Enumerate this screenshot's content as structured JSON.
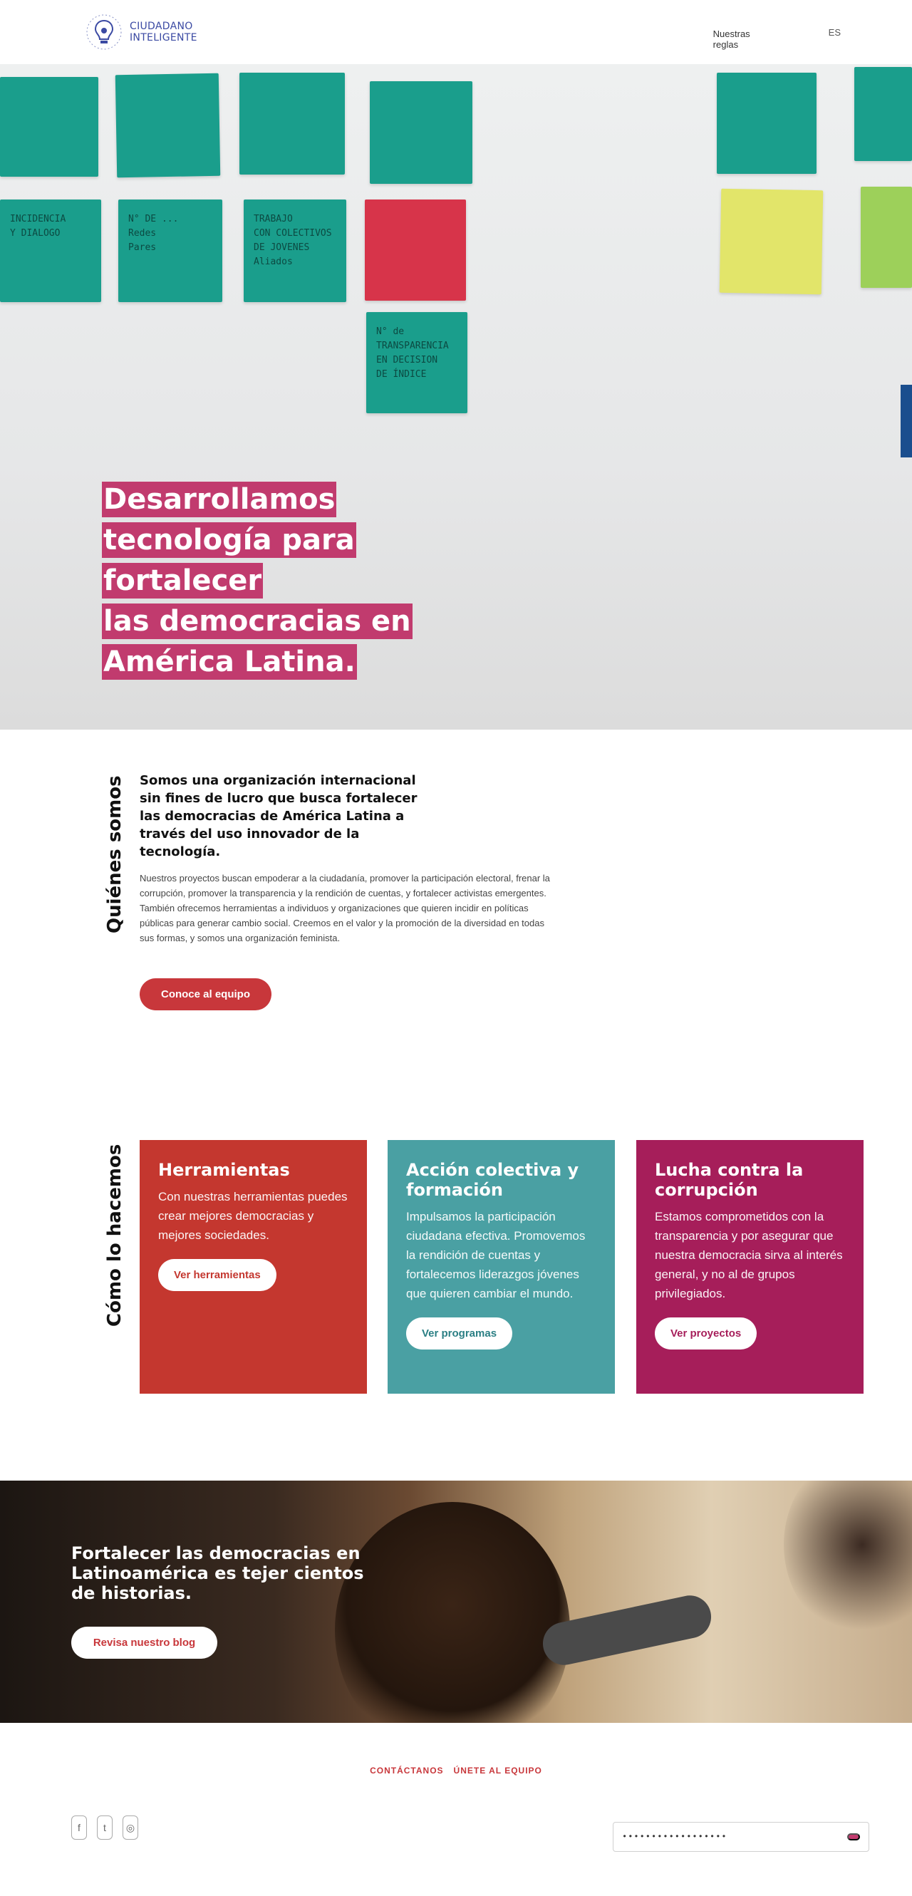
{
  "header": {
    "logo": {
      "line1": "CIUDADANO",
      "line2": "INTELIGENTE",
      "icon": "lightbulb-icon"
    },
    "nav": [
      "",
      "",
      "Nuestras reglas",
      ""
    ],
    "lang": [
      "ES"
    ]
  },
  "hero": {
    "notes": [
      {
        "lines": [
          "INCIDENCIA",
          "Y DIALOGO"
        ]
      },
      {
        "lines": [
          "N° DE ...",
          "Redes",
          "Pares"
        ]
      },
      {
        "lines": [
          "TRABAJO",
          "CON COLECTIVOS",
          "DE JOVENES",
          "Aliados"
        ]
      },
      {
        "lines": [
          "N° de",
          "TRANSPARENCIA",
          "EN DECISION",
          "DE ÍNDICE"
        ]
      }
    ],
    "title_lines": [
      "Desarrollamos",
      "tecnología para",
      "fortalecer",
      "las democracias en",
      "América Latina."
    ]
  },
  "about": {
    "heading": "Quiénes somos",
    "lead": "Somos una organización internacional sin fines de lucro que busca fortalecer las democracias de América Latina a través del uso innovador de la tecnología.",
    "body": "Nuestros proyectos buscan empoderar a la ciudadanía, promover la participación electoral, frenar la corrupción, promover la transparencia y la rendición de cuentas, y fortalecer activistas emergentes. También ofrecemos herramientas a individuos y organizaciones que quieren incidir en políticas públicas para generar cambio social. Creemos en el valor y la promoción de la diversidad en todas sus formas, y somos una organización feminista.",
    "button": "Conoce al equipo"
  },
  "how": {
    "heading": "Cómo lo hacemos",
    "cards": [
      {
        "title": "Herramientas",
        "body": "Con nuestras herramientas puedes crear mejores democracias y mejores sociedades.",
        "button": "Ver herramientas"
      },
      {
        "title": "Acción colectiva y formación",
        "body": "Impulsamos la participación ciudadana efectiva. Promovemos la rendición de cuentas y fortalecemos liderazgos jóvenes que quieren cambiar el mundo.",
        "button": "Ver programas"
      },
      {
        "title": "Lucha contra la corrupción",
        "body": "Estamos comprometidos con la transparencia y por asegurar que nuestra democracia sirva al interés general, y no al de grupos privilegiados.",
        "button": "Ver proyectos"
      }
    ]
  },
  "banner": {
    "title": "Fortalecer las democracias en Latinoamérica es tejer cientos de historias.",
    "button": "Revisa nuestro blog"
  },
  "footer": {
    "links": [
      "CONTÁCTANOS",
      "ÚNETE AL EQUIPO"
    ],
    "social": [
      "facebook-icon",
      "twitter-icon",
      "instagram-icon"
    ],
    "subscribe_placeholder": "••••••••••••••••••"
  }
}
